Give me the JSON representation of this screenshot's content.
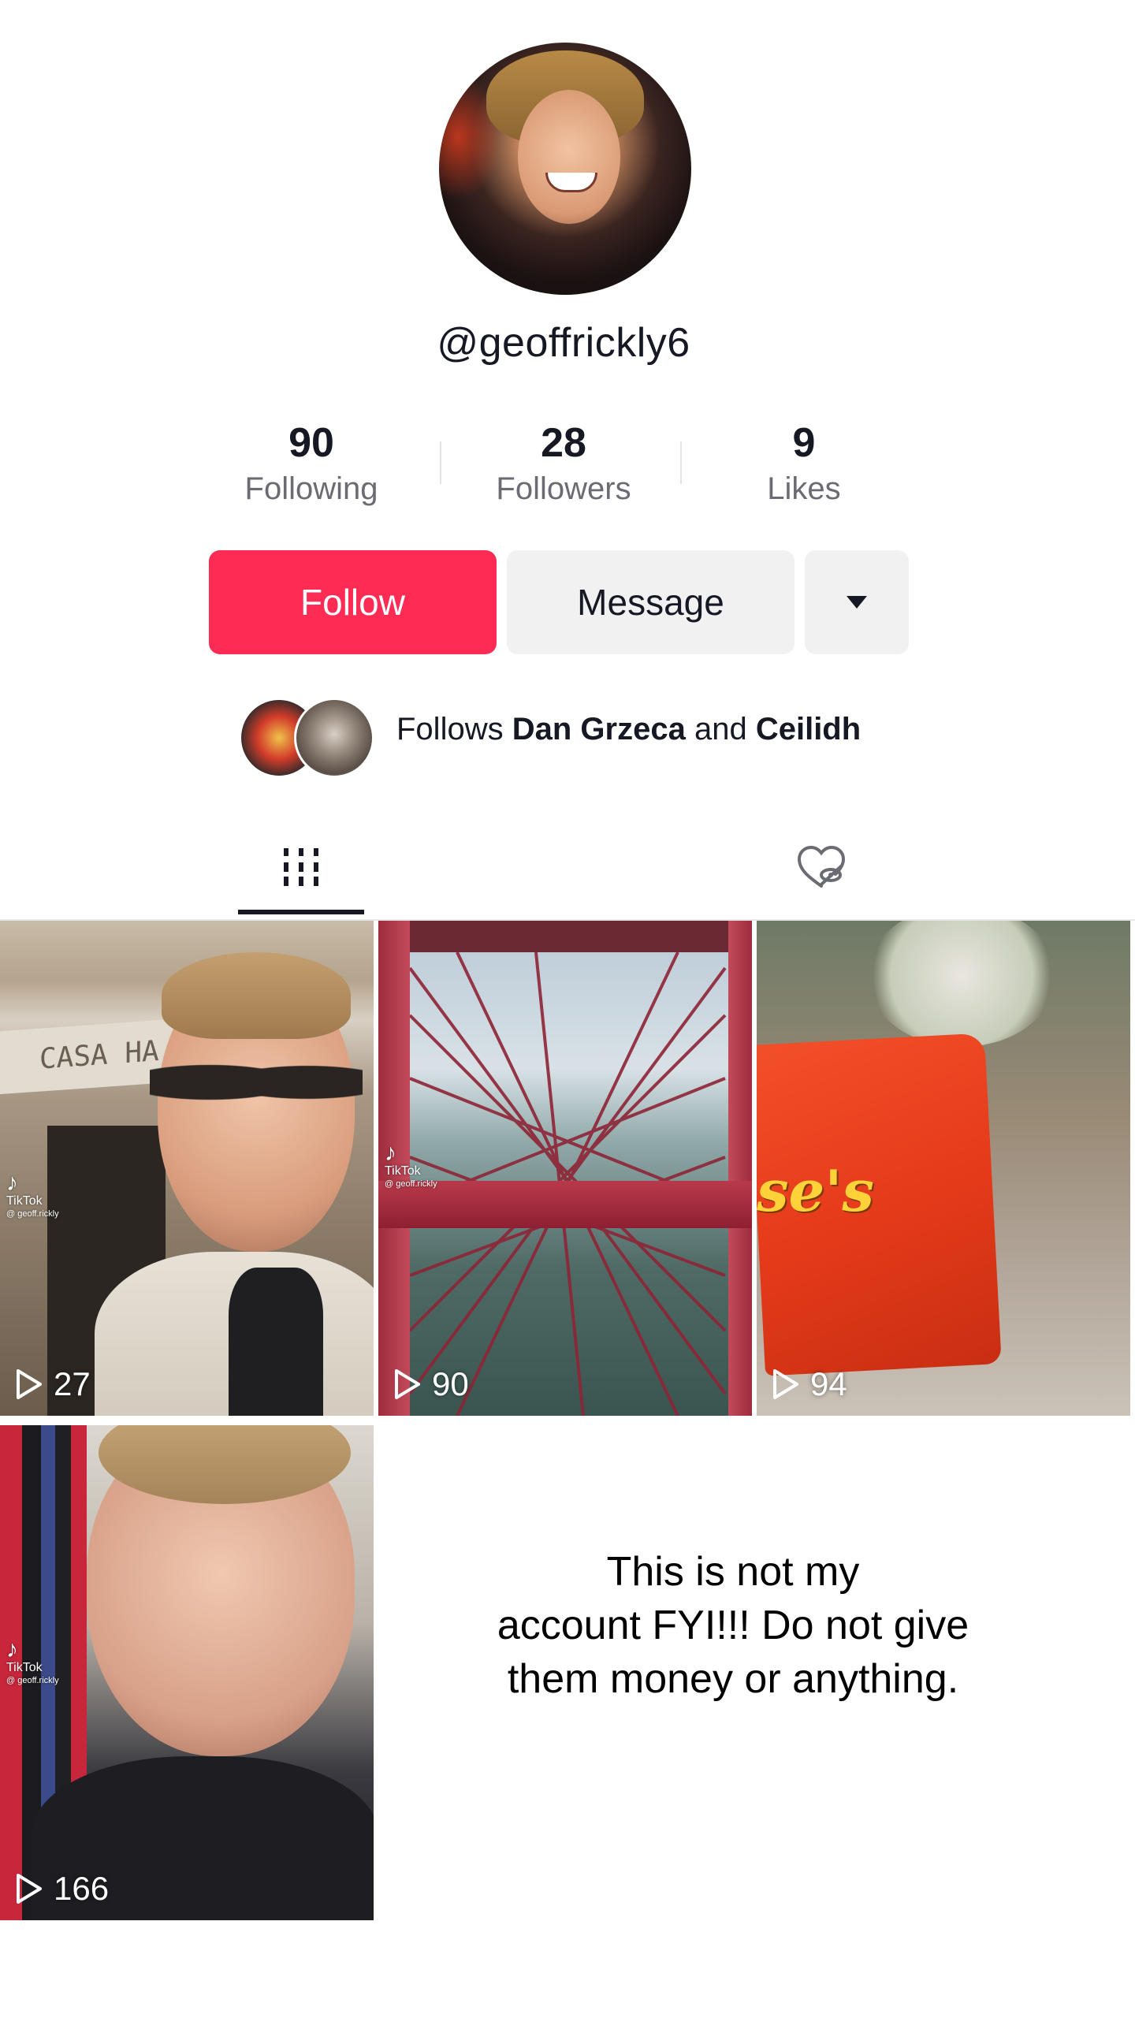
{
  "profile": {
    "username": "@geoffrickly6",
    "stats": [
      {
        "value": "90",
        "label": "Following"
      },
      {
        "value": "28",
        "label": "Followers"
      },
      {
        "value": "9",
        "label": "Likes"
      }
    ]
  },
  "actions": {
    "follow_label": "Follow",
    "message_label": "Message",
    "more_icon": "caret-down-icon"
  },
  "mutuals": {
    "prefix": "Follows",
    "name1": "Dan Grzeca",
    "joiner": "and",
    "name2": "Ceilidh"
  },
  "tabs": [
    {
      "icon": "grid-icon",
      "active": true
    },
    {
      "icon": "liked-hidden-icon",
      "active": false
    }
  ],
  "videos": [
    {
      "views": "27",
      "watermark": "TikTok",
      "watermark_user": "@ geoff.rickly",
      "sign_text": "CASA HA"
    },
    {
      "views": "90",
      "watermark": "TikTok",
      "watermark_user": "@ geoff.rickly"
    },
    {
      "views": "94",
      "brand_fragment": "se's"
    },
    {
      "views": "166",
      "watermark": "TikTok",
      "watermark_user": "@ geoff.rickly"
    }
  ],
  "notice": {
    "line1": "This is not my",
    "line2": "account FYI!!! Do not give",
    "line3": "them money or anything."
  },
  "colors": {
    "follow_button": "#fe2c55",
    "secondary_button": "#f1f1f2",
    "text": "#161823",
    "muted_text": "#6b6b73"
  }
}
